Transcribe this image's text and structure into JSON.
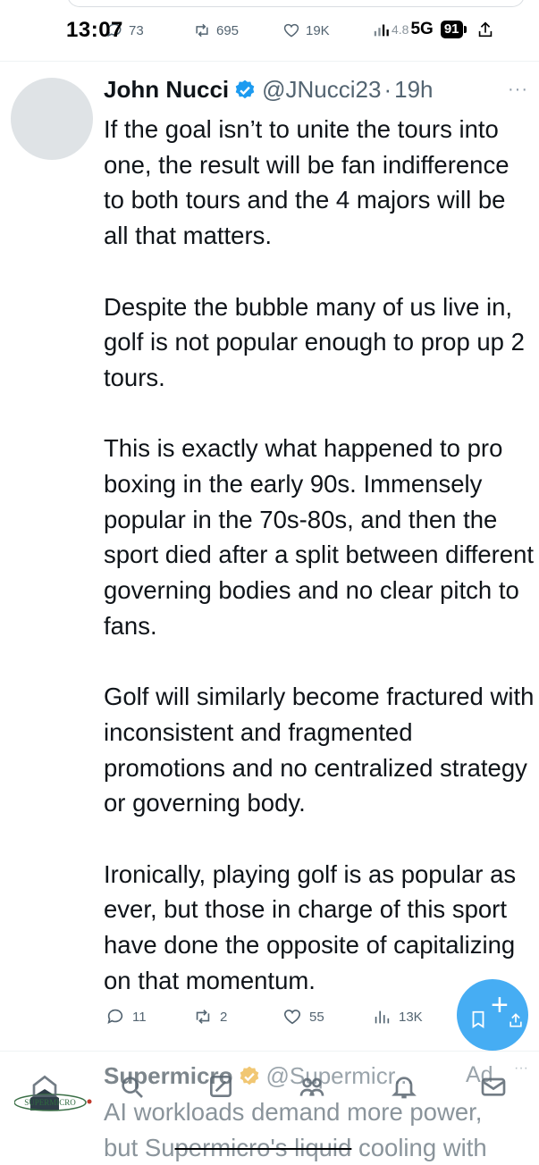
{
  "status_bar": {
    "time": "13:07",
    "signal_text": "4.8",
    "network": "5G",
    "battery": "91"
  },
  "previous_tweet_actions": {
    "replies": "73",
    "retweets": "695",
    "likes": "19K",
    "views": "4.8M"
  },
  "tweet": {
    "author_name": "John Nucci",
    "handle": "@JNucci23",
    "separator": "·",
    "time": "19h",
    "verified_color": "#1d9bf0",
    "paragraphs": [
      "If the goal isn’t to unite the tours into one, the result will be fan indifference to both tours and the 4 majors will be all that matters.",
      "Despite the bubble many of us live in, golf is not popular enough to prop up 2 tours.",
      "This is exactly what happened to pro boxing in the early 90s. Immensely popular in the 70s-80s, and then the sport died after a split between different governing bodies and no clear pitch to fans.",
      "Golf will similarly become fractured with inconsistent and fragmented promotions and no centralized strategy or governing body.",
      "Ironically, playing golf is as popular as ever, but those in charge of this sport have done the opposite of capitalizing on that momentum."
    ],
    "actions": {
      "replies": "11",
      "retweets": "2",
      "likes": "55",
      "views": "13K"
    }
  },
  "ad_tweet": {
    "author_name": "Supermicro",
    "handle": "@Supermicr...",
    "ad_label": "Ad",
    "verified_color": "#e8a317",
    "logo_text": "SUPERMICRO",
    "body_line1": "AI workloads demand more power,",
    "body_line2_start": "but Su",
    "body_line2_strike": "permicro's liquid",
    "body_line2_end": " cooling with"
  },
  "colors": {
    "accent": "#1d9bf0",
    "text": "#0f1419",
    "muted": "#536471"
  }
}
